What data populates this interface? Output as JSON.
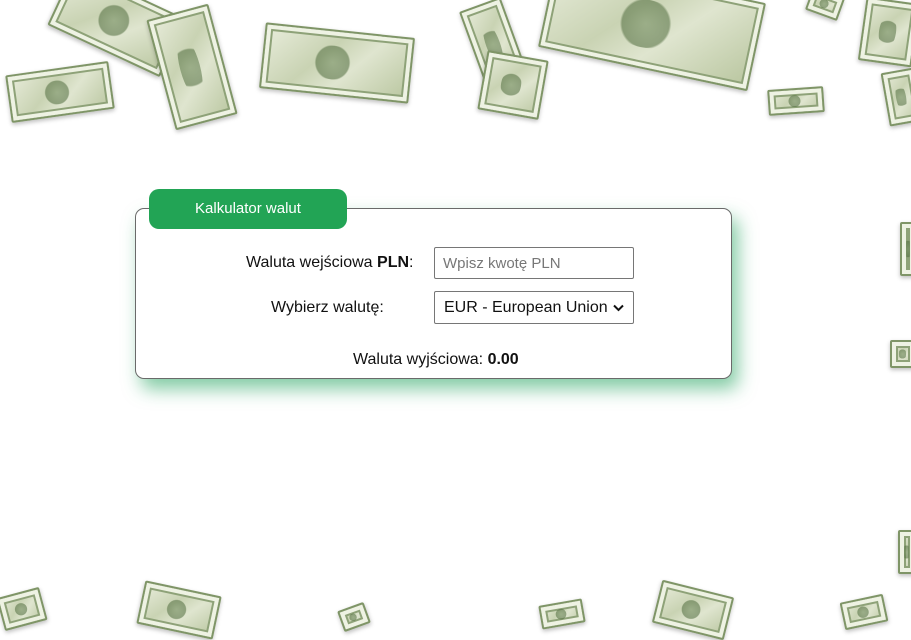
{
  "calculator": {
    "title": "Kalkulator walut",
    "input_label_prefix": "Waluta wejściowa ",
    "input_label_currency": "PLN",
    "input_label_suffix": ":",
    "input_placeholder": "Wpisz kwotę PLN",
    "input_value": "",
    "select_label": "Wybierz walutę:",
    "selected_currency": "EUR - European Union",
    "output_label": "Waluta wyjściowa: ",
    "output_value": "0.00"
  },
  "colors": {
    "accent": "#22a455",
    "card_shadow": "#1ea05a",
    "card_border": "#6a6a6a"
  },
  "background": {
    "decoration": "falling-dollar-bills"
  }
}
